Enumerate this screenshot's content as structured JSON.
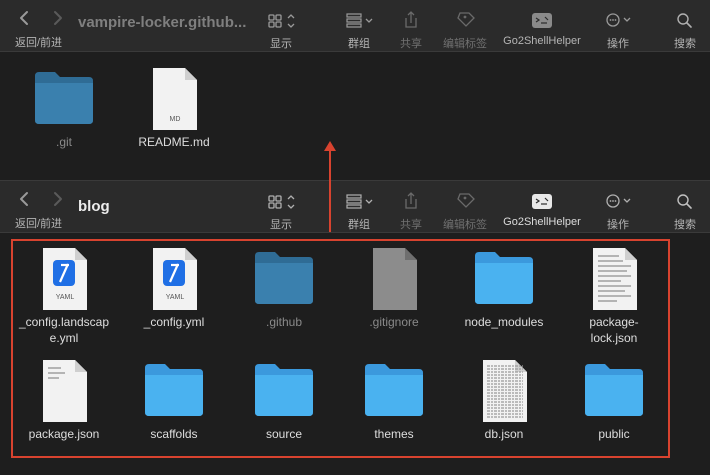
{
  "windows": [
    {
      "title": "vampire-locker.github...",
      "nav_label": "返回/前进",
      "toolbar": {
        "view": "显示",
        "group": "群组",
        "share": "共享",
        "tags": "编辑标签",
        "go2shell": "Go2ShellHelper",
        "action": "操作",
        "search": "搜索"
      },
      "files": [
        {
          "name": ".git",
          "icon": "folder-icon",
          "hidden": true
        },
        {
          "name": "README.md",
          "icon": "markdown-file-icon",
          "badge": "MD",
          "hidden": false
        }
      ]
    },
    {
      "title": "blog",
      "nav_label": "返回/前进",
      "toolbar": {
        "view": "显示",
        "group": "群组",
        "share": "共享",
        "tags": "编辑标签",
        "go2shell": "Go2ShellHelper",
        "action": "操作",
        "search": "搜索"
      },
      "files": [
        {
          "name": "_config.landscape.yml",
          "line1": "_config.landscap",
          "line2": "e.yml",
          "icon": "yaml-file-icon",
          "badge": "YAML",
          "hidden": false
        },
        {
          "name": "_config.yml",
          "line1": "_config.yml",
          "line2": "",
          "icon": "yaml-file-icon",
          "badge": "YAML",
          "hidden": false
        },
        {
          "name": ".github",
          "line1": ".github",
          "line2": "",
          "icon": "folder-icon",
          "hidden": true
        },
        {
          "name": ".gitignore",
          "line1": ".gitignore",
          "line2": "",
          "icon": "document-icon",
          "hidden": true
        },
        {
          "name": "node_modules",
          "line1": "node_modules",
          "line2": "",
          "icon": "folder-icon",
          "hidden": false
        },
        {
          "name": "package-lock.json",
          "line1": "package-",
          "line2": "lock.json",
          "icon": "json-file-icon",
          "hidden": false
        },
        {
          "name": "package.json",
          "line1": "package.json",
          "line2": "",
          "icon": "json-file-icon",
          "hidden": false
        },
        {
          "name": "scaffolds",
          "line1": "scaffolds",
          "line2": "",
          "icon": "folder-icon",
          "hidden": false
        },
        {
          "name": "source",
          "line1": "source",
          "line2": "",
          "icon": "folder-icon",
          "hidden": false
        },
        {
          "name": "themes",
          "line1": "themes",
          "line2": "",
          "icon": "folder-icon",
          "hidden": false
        },
        {
          "name": "db.json",
          "line1": "db.json",
          "line2": "",
          "icon": "json-file-icon",
          "hidden": false
        },
        {
          "name": "public",
          "line1": "public",
          "line2": "",
          "icon": "folder-icon",
          "hidden": false
        }
      ]
    }
  ],
  "colors": {
    "annotation": "#d8432f",
    "folder": "#4aa9e9",
    "hidden_folder": "#2f6c95",
    "toolbar_bg": "#2b2b2b",
    "window_bg": "#1e1e1e"
  }
}
